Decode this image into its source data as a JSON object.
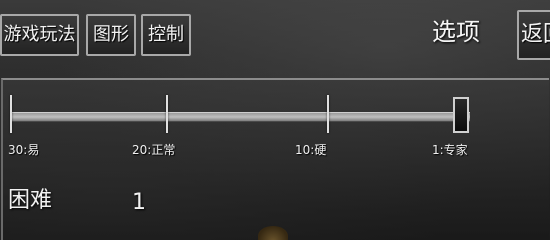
{
  "tabs": [
    {
      "label": "游戏玩法"
    },
    {
      "label": "图形"
    },
    {
      "label": "控制"
    }
  ],
  "header": {
    "title": "选项",
    "back_label": "返回"
  },
  "difficulty_slider": {
    "tick_labels": [
      "30:易",
      "20:正常",
      "10:硬",
      "1:专家"
    ],
    "position": 1.0
  },
  "difficulty": {
    "label": "困难",
    "value": "1"
  }
}
